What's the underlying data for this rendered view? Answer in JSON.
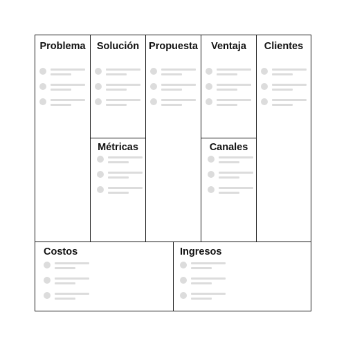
{
  "canvas": {
    "blocks": {
      "problema": {
        "title": "Problema"
      },
      "solucion": {
        "title": "Solución"
      },
      "metricas": {
        "title": "Métricas"
      },
      "propuesta": {
        "title": "Propuesta"
      },
      "ventaja": {
        "title": "Ventaja"
      },
      "canales": {
        "title": "Canales"
      },
      "clientes": {
        "title": "Clientes"
      },
      "costos": {
        "title": "Costos"
      },
      "ingresos": {
        "title": "Ingresos"
      }
    },
    "placeholder_items_per_block": 3,
    "colors": {
      "border": "#1a1a1a",
      "placeholder": "#dcdcdc",
      "text": "#111111"
    }
  }
}
